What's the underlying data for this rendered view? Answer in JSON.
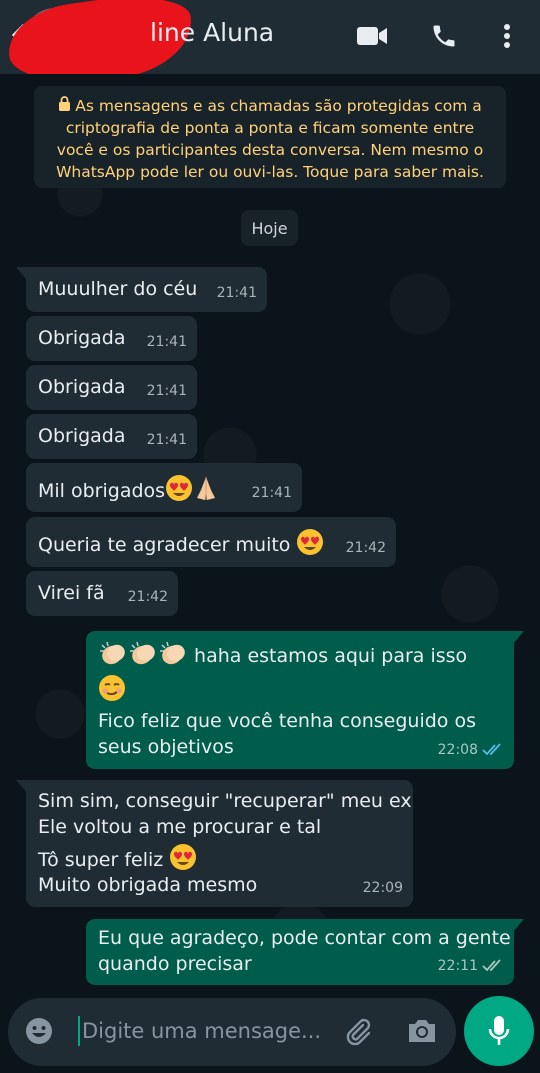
{
  "header": {
    "title": "line Aluna",
    "icons": [
      "back-arrow-icon",
      "video-call-icon",
      "phone-icon",
      "more-options-icon"
    ]
  },
  "encryption_notice": {
    "text": "As mensagens e as chamadas são protegidas com a criptografia de ponta a ponta e ficam somente entre você e os participantes desta conversa. Nem mesmo o WhatsApp pode ler ou ouvi-las. Toque para saber mais.",
    "color": "#ffd279"
  },
  "day_separator": "Hoje",
  "messages": [
    {
      "direction": "in",
      "lines": [
        "Muuulher do céu"
      ],
      "time": "21:41"
    },
    {
      "direction": "in",
      "lines": [
        "Obrigada"
      ],
      "time": "21:41"
    },
    {
      "direction": "in",
      "lines": [
        "Obrigada"
      ],
      "time": "21:41"
    },
    {
      "direction": "in",
      "lines": [
        "Obrigada"
      ],
      "time": "21:41"
    },
    {
      "direction": "in",
      "lines": [
        "Mil obrigados"
      ],
      "emoji": [
        "heart-eyes",
        "praying-hands"
      ],
      "time": "21:41"
    },
    {
      "direction": "in",
      "lines": [
        "Queria te agradecer muito"
      ],
      "emoji": [
        "heart-eyes"
      ],
      "time": "21:42"
    },
    {
      "direction": "in",
      "lines": [
        "Virei fã"
      ],
      "time": "21:42"
    },
    {
      "direction": "out",
      "lines": [
        "haha estamos aqui para isso",
        "Fico feliz que você tenha conseguido os",
        "seus objetivos"
      ],
      "emoji": [
        "clapping-hands",
        "clapping-hands",
        "clapping-hands",
        "smirking-face"
      ],
      "time": "22:08",
      "status": "read"
    },
    {
      "direction": "in",
      "lines": [
        "Sim sim, conseguir \"recuperar\" meu ex",
        "Ele voltou a me procurar e tal",
        "Tô super feliz",
        "Muito obrigada mesmo"
      ],
      "emoji": [
        "heart-eyes"
      ],
      "time": "22:09"
    },
    {
      "direction": "out",
      "lines": [
        "Eu que agradeço, pode contar com a gente",
        "quando precisar"
      ],
      "time": "22:11",
      "status": "delivered"
    }
  ],
  "input": {
    "placeholder": "Digite uma mensage..."
  },
  "colors": {
    "header_bg": "#1f2c34",
    "incoming_bubble": "#1f2c34",
    "outgoing_bubble": "#005c4b",
    "accent": "#00a884",
    "read_ticks": "#53bdeb"
  }
}
